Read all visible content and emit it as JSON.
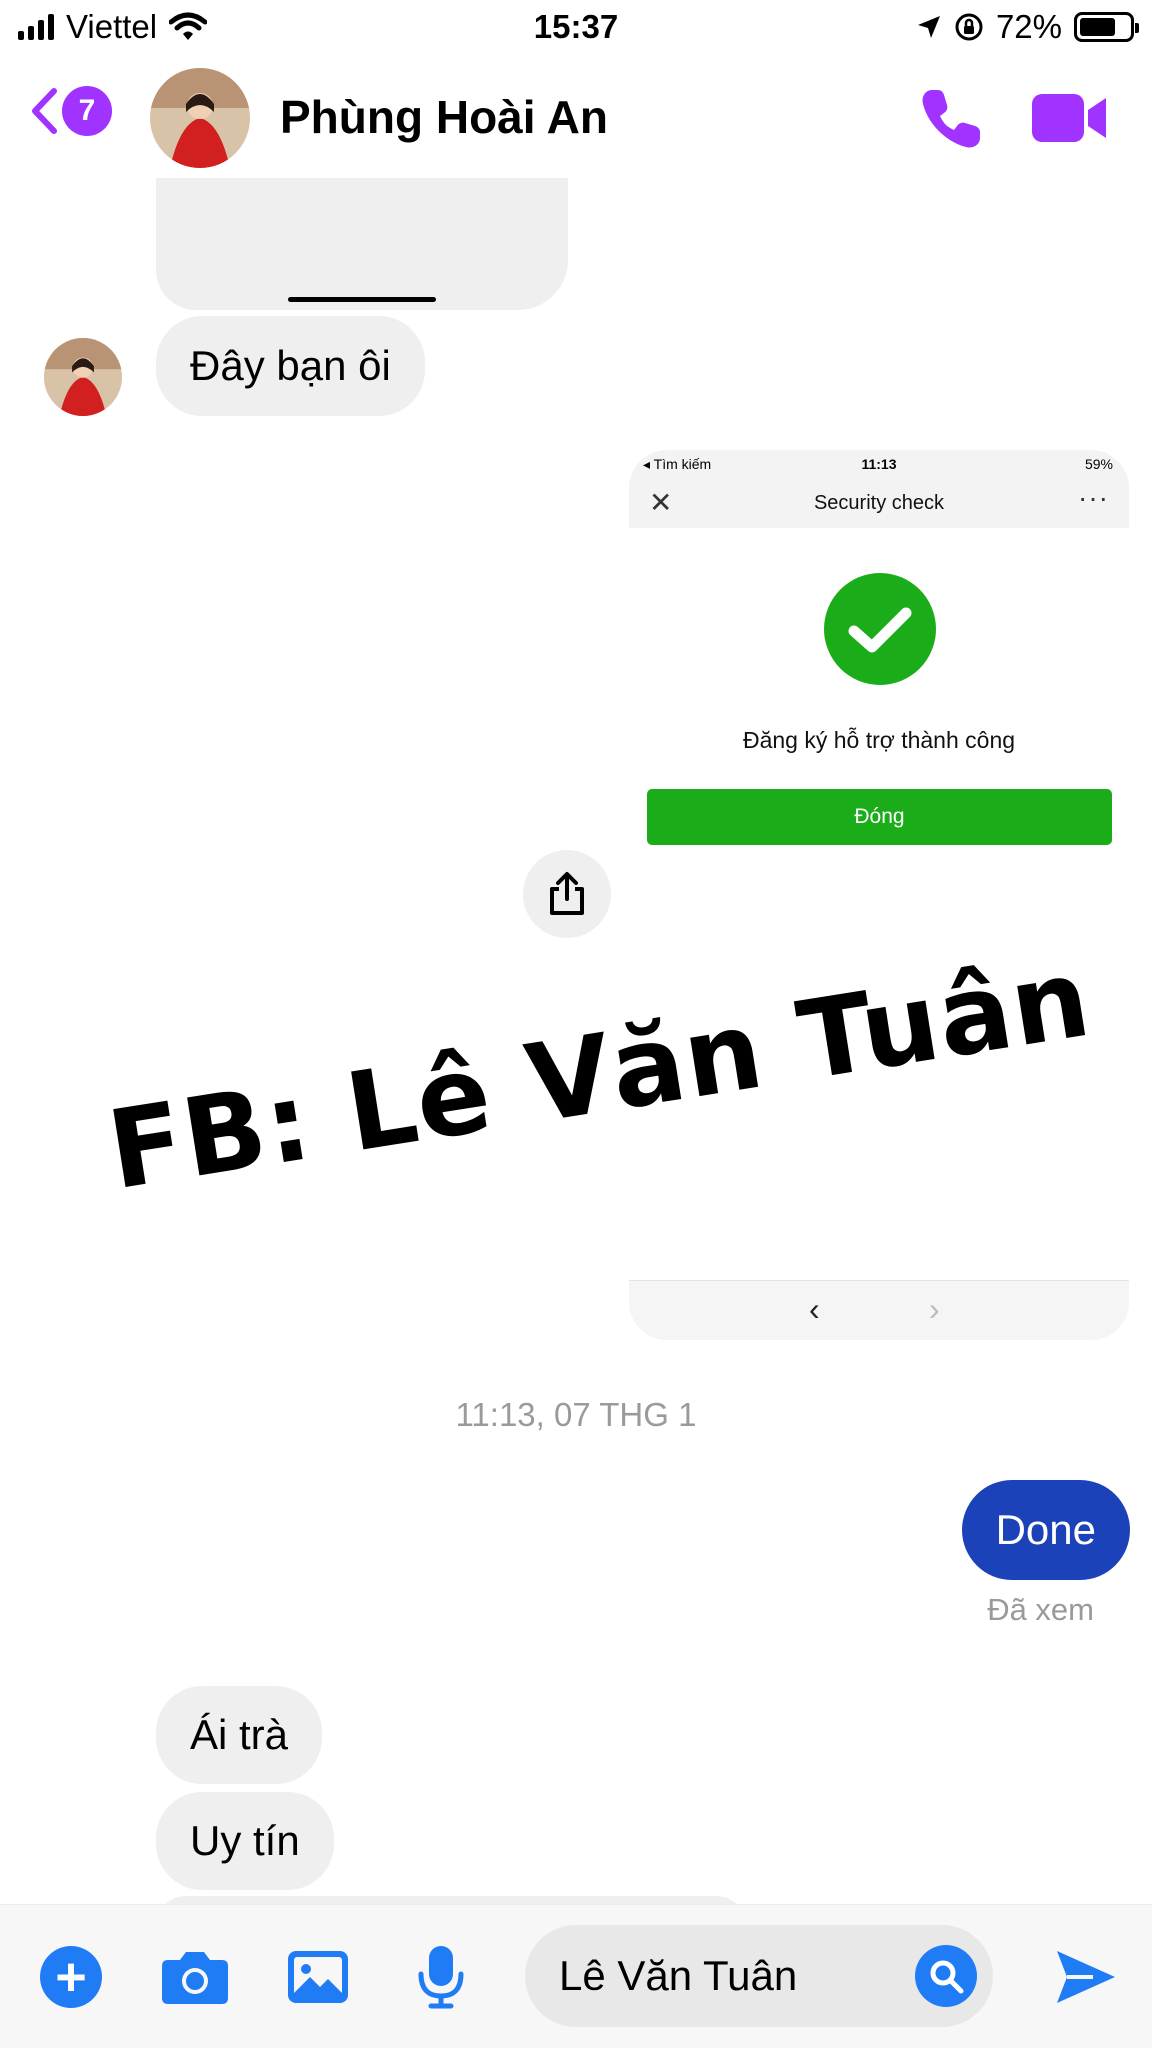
{
  "status_bar": {
    "carrier": "Viettel",
    "time": "15:37",
    "battery_percent": "72%",
    "battery_level": 0.72
  },
  "header": {
    "back_badge_count": "7",
    "contact_name": "Phùng Hoài An",
    "accent_color": "#a033ff"
  },
  "messages": {
    "incoming_1": "Đây bạn ôi",
    "timestamp": "11:13, 07 THG 1",
    "outgoing_1": "Done",
    "seen_status": "Đã xem",
    "incoming_2": "Ái trà",
    "incoming_3": "Uy tín"
  },
  "shared_screenshot": {
    "status_left": "◂ Tìm kiếm",
    "status_time": "11:13",
    "status_battery": "59%",
    "title": "Security check",
    "success_message": "Đăng ký hỗ trợ thành công",
    "close_button": "Đóng",
    "accent_color": "#1aad19"
  },
  "watermark": "FB: Lê Văn Tuân",
  "composer": {
    "input_value": "Lê Văn Tuân",
    "accent_color": "#1f7cf5"
  },
  "icons": {
    "call": "phone-icon",
    "video": "video-camera-icon",
    "share": "share-icon",
    "plus": "plus-icon",
    "camera": "camera-icon",
    "gallery": "image-icon",
    "mic": "microphone-icon",
    "search": "search-icon",
    "send": "send-icon"
  }
}
